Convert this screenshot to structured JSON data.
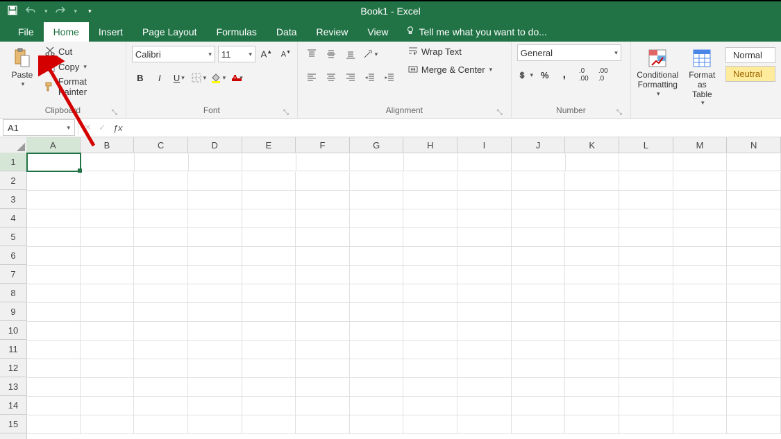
{
  "title": "Book1 - Excel",
  "tabs": {
    "file": "File",
    "home": "Home",
    "insert": "Insert",
    "pagelayout": "Page Layout",
    "formulas": "Formulas",
    "data": "Data",
    "review": "Review",
    "view": "View",
    "tellme": "Tell me what you want to do..."
  },
  "ribbon": {
    "clipboard": {
      "paste": "Paste",
      "cut": "Cut",
      "copy": "Copy",
      "format_painter": "Format Painter",
      "label": "Clipboard"
    },
    "font": {
      "name": "Calibri",
      "size": "11",
      "label": "Font"
    },
    "alignment": {
      "wrap": "Wrap Text",
      "merge": "Merge & Center",
      "label": "Alignment"
    },
    "number": {
      "format": "General",
      "label": "Number"
    },
    "styles": {
      "conditional": "Conditional\nFormatting",
      "formatas": "Format as\nTable",
      "normal": "Normal",
      "neutral": "Neutral"
    }
  },
  "namebox": "A1",
  "columns": [
    "A",
    "B",
    "C",
    "D",
    "E",
    "F",
    "G",
    "H",
    "I",
    "J",
    "K",
    "L",
    "M",
    "N"
  ],
  "rows": [
    "1",
    "2",
    "3",
    "4",
    "5",
    "6",
    "7",
    "8",
    "9",
    "10",
    "11",
    "12",
    "13",
    "14",
    "15"
  ],
  "active_cell": "A1"
}
